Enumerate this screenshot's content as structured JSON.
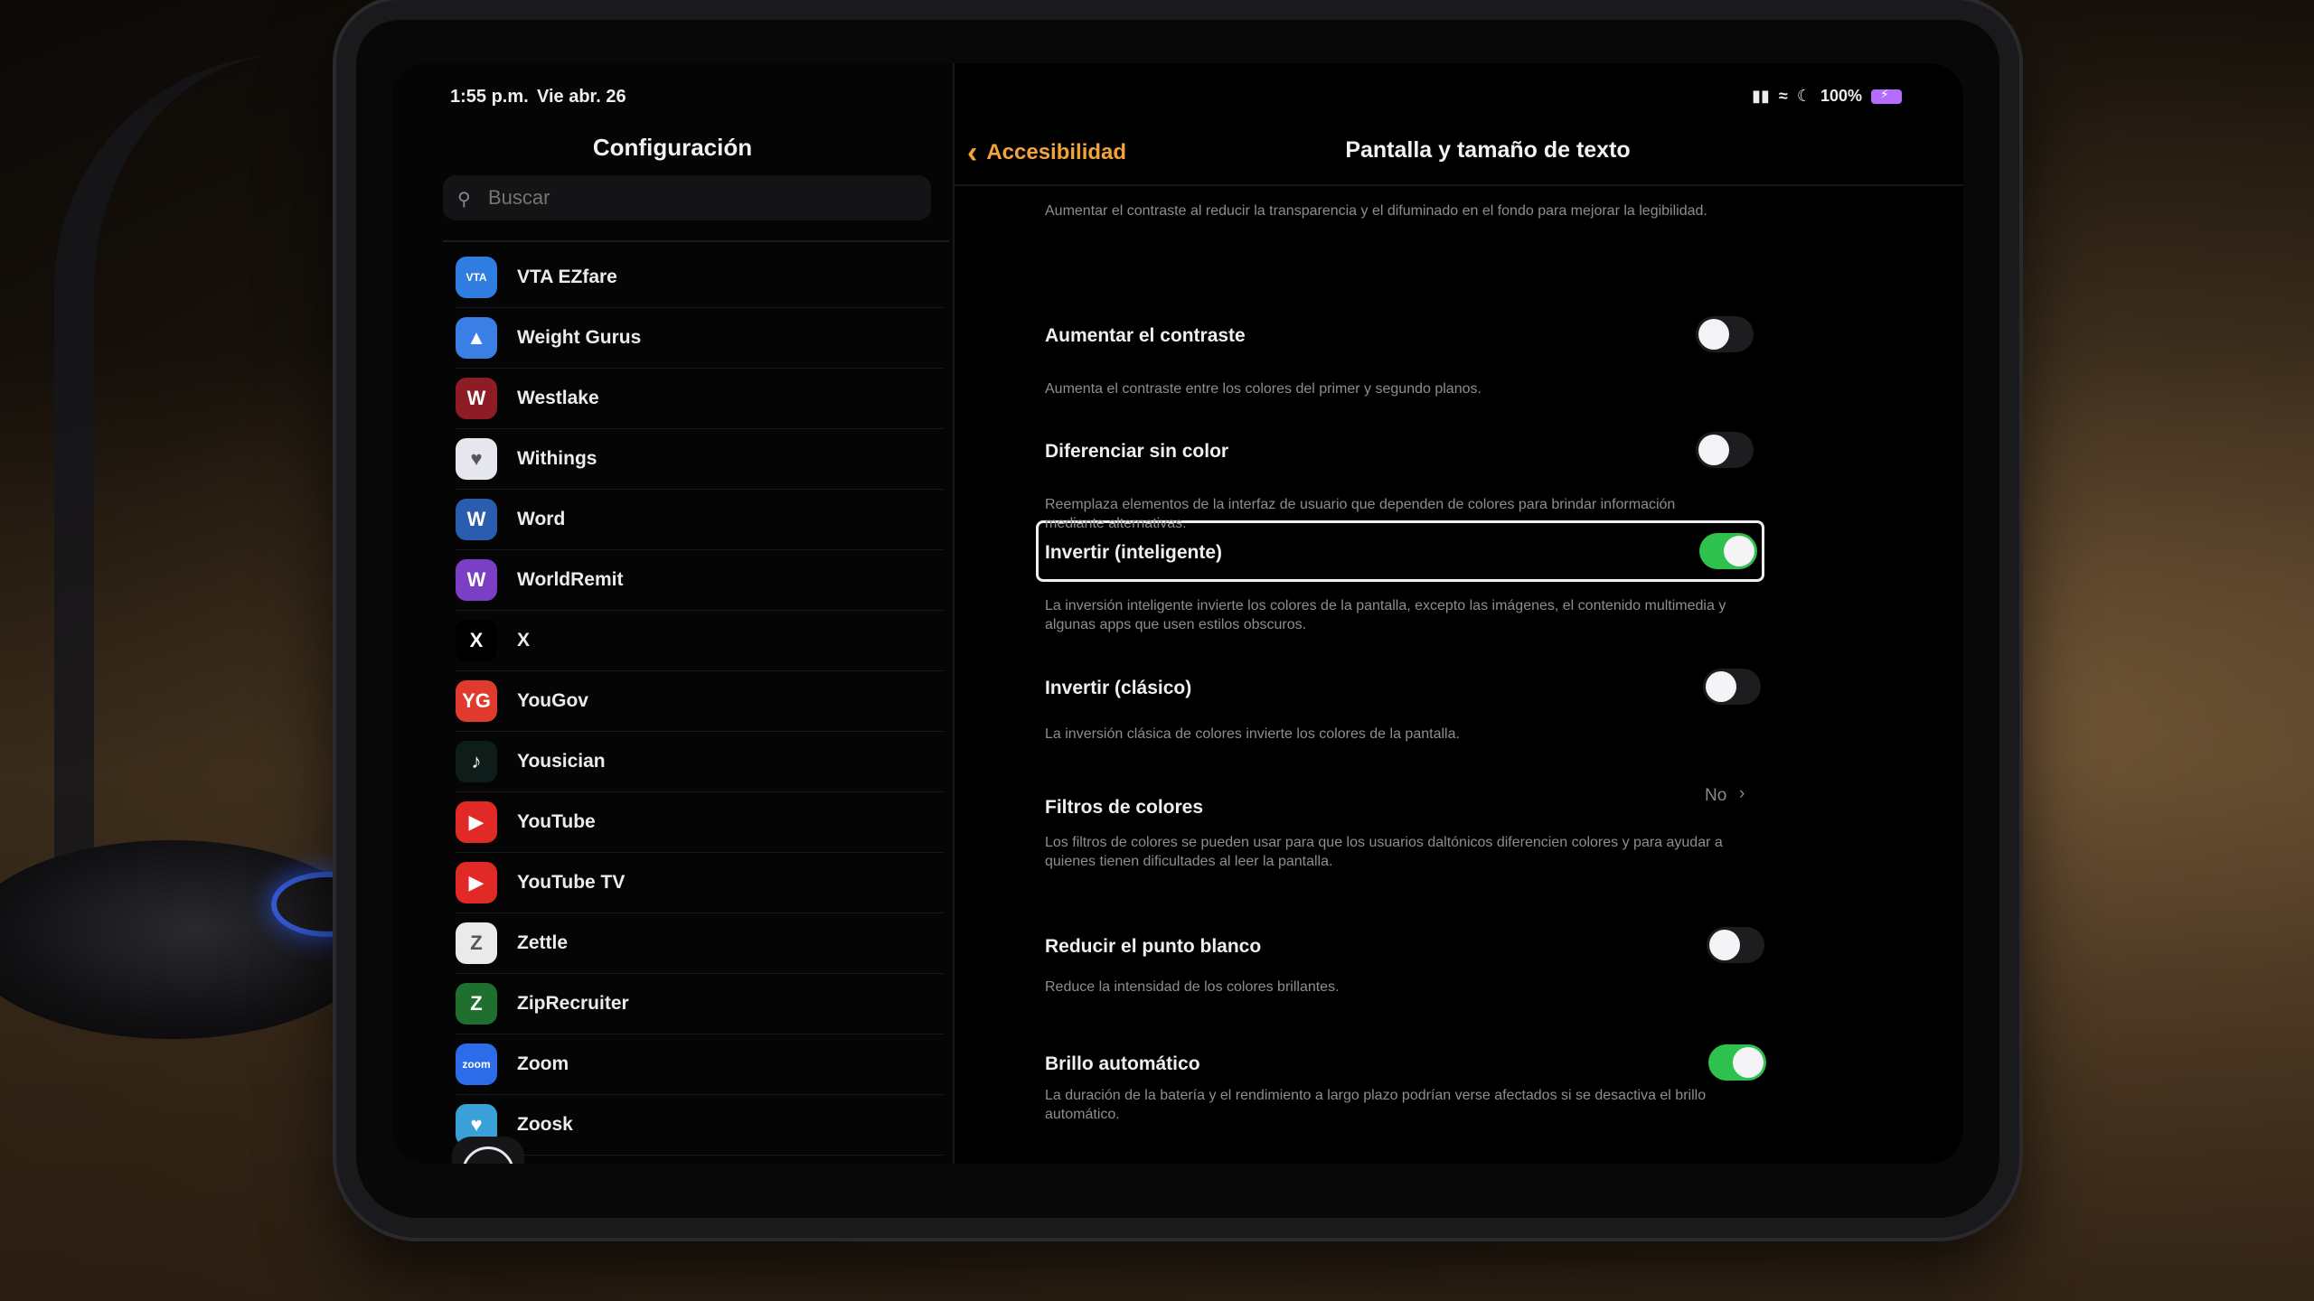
{
  "status": {
    "time": "1:55 p.m.",
    "date": "Vie abr. 26",
    "battery": "100%"
  },
  "sidebar": {
    "title": "Configuración",
    "search_placeholder": "Buscar",
    "apps": [
      {
        "label": "VTA EZfare",
        "icon": "VTA",
        "color": "#2f7de1"
      },
      {
        "label": "Weight Gurus",
        "icon": "▲",
        "color": "#3a7ee6"
      },
      {
        "label": "Westlake",
        "icon": "W",
        "color": "#8e1c24"
      },
      {
        "label": "Withings",
        "icon": "♥",
        "color": "#e6e6ee"
      },
      {
        "label": "Word",
        "icon": "W",
        "color": "#2a5db0"
      },
      {
        "label": "WorldRemit",
        "icon": "W",
        "color": "#7a3fc4"
      },
      {
        "label": "X",
        "icon": "X",
        "color": "#000000"
      },
      {
        "label": "YouGov",
        "icon": "YG",
        "color": "#e03a2f"
      },
      {
        "label": "Yousician",
        "icon": "♪",
        "color": "#0f1d1a"
      },
      {
        "label": "YouTube",
        "icon": "▶",
        "color": "#e12a25"
      },
      {
        "label": "YouTube TV",
        "icon": "▶",
        "color": "#e12a25"
      },
      {
        "label": "Zettle",
        "icon": "Z",
        "color": "#eaeaea"
      },
      {
        "label": "ZipRecruiter",
        "icon": "Z",
        "color": "#1f6f2e"
      },
      {
        "label": "Zoom",
        "icon": "zoom",
        "color": "#2d6ce8"
      },
      {
        "label": "Zoosk",
        "icon": "♥",
        "color": "#3aa0d8"
      }
    ]
  },
  "detail": {
    "back_label": "Accesibilidad",
    "title": "Pantalla y tamaño de texto",
    "intro": "Aumentar el contraste al reducir la transparencia y el difuminado en el fondo para mejorar la legibilidad.",
    "settings": [
      {
        "label": "Aumentar el contraste",
        "desc": "Aumenta el contraste entre los colores del primer y segundo planos.",
        "state": "off"
      },
      {
        "label": "Diferenciar sin color",
        "desc": "Reemplaza elementos de la interfaz de usuario que dependen de colores para brindar información mediante alternativas.",
        "state": "off"
      },
      {
        "label": "Invertir (inteligente)",
        "desc": "La inversión inteligente invierte los colores de la pantalla, excepto las imágenes, el contenido multimedia y algunas apps que usen estilos obscuros.",
        "state": "on"
      },
      {
        "label": "Invertir (clásico)",
        "desc": "La inversión clásica de colores invierte los colores de la pantalla.",
        "state": "off"
      },
      {
        "label": "Filtros de colores",
        "desc": "Los filtros de colores se pueden usar para que los usuarios daltónicos diferencien colores y para ayudar a quienes tienen dificultades al leer la pantalla.",
        "value": "No"
      },
      {
        "label": "Reducir el punto blanco",
        "desc": "Reduce la intensidad de los colores brillantes.",
        "state": "off"
      },
      {
        "label": "Brillo automático",
        "desc": "La duración de la batería y el rendimiento a largo plazo podrían verse afectados si se desactiva el brillo automático.",
        "state": "on"
      }
    ]
  },
  "colors": {
    "accent": "#f2a33a",
    "toggle_on": "#2fc14e"
  }
}
